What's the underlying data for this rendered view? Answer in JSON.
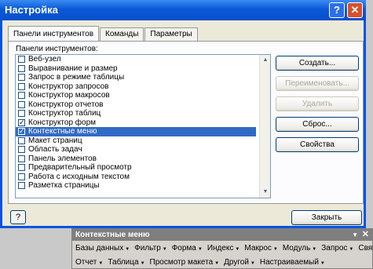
{
  "dialog": {
    "title": "Настройка",
    "help_button": "?",
    "close_button": "✕",
    "tabs": [
      "Панели инструментов",
      "Команды",
      "Параметры"
    ],
    "list_label": "Панели инструментов:",
    "toolbars": [
      {
        "label": "Веб-узел",
        "checked": false
      },
      {
        "label": "Выравнивание и размер",
        "checked": false
      },
      {
        "label": "Запрос в режиме таблицы",
        "checked": false
      },
      {
        "label": "Конструктор запросов",
        "checked": false
      },
      {
        "label": "Конструктор макросов",
        "checked": false
      },
      {
        "label": "Конструктор отчетов",
        "checked": false
      },
      {
        "label": "Конструктор таблиц",
        "checked": false
      },
      {
        "label": "Конструктор форм",
        "checked": true
      },
      {
        "label": "Контекстные меню",
        "checked": true,
        "selected": true
      },
      {
        "label": "Макет страниц",
        "checked": false
      },
      {
        "label": "Область задач",
        "checked": false
      },
      {
        "label": "Панель элементов",
        "checked": false
      },
      {
        "label": "Предварительный просмотр",
        "checked": false
      },
      {
        "label": "Работа с исходным текстом",
        "checked": false
      },
      {
        "label": "Разметка страницы",
        "checked": false
      }
    ],
    "buttons": {
      "create": "Создать...",
      "rename": "Переименовать...",
      "delete": "Удалить",
      "reset": "Сброс...",
      "properties": "Свойства"
    },
    "footer_help": "?",
    "close": "Закрыть"
  },
  "context_toolbar": {
    "title": "Контекстные меню",
    "row1": [
      "Базы данных",
      "Фильтр",
      "Форма",
      "Индекс",
      "Макрос",
      "Модуль",
      "Запрос",
      "Связь"
    ],
    "row2": [
      "Отчет",
      "Таблица",
      "Просмотр макета",
      "Другой",
      "Настраиваемый"
    ]
  }
}
